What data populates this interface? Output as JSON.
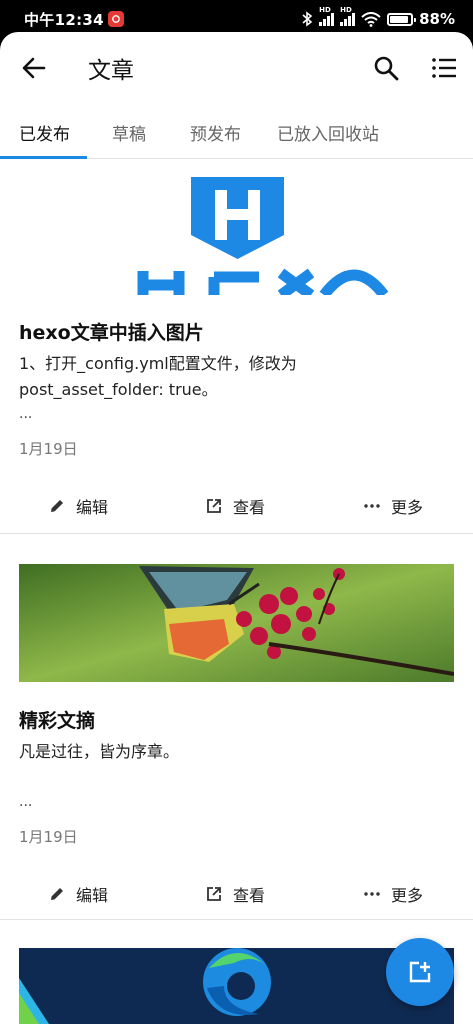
{
  "status_bar": {
    "time": "中午12:34",
    "battery_level": "88%",
    "battery_fraction": 0.88,
    "signal_label_1": "HD",
    "signal_label_2": "HD"
  },
  "appbar": {
    "title": "文章",
    "back_icon": "arrow-left-icon",
    "search_icon": "search-icon",
    "list_icon": "list-icon"
  },
  "tabs": [
    {
      "label": "已发布",
      "active": true
    },
    {
      "label": "草稿",
      "active": false
    },
    {
      "label": "预发布",
      "active": false
    },
    {
      "label": "已放入回收站",
      "active": false
    }
  ],
  "articles": [
    {
      "image": "hexo-logo",
      "image_text": "HEXO",
      "title": "hexo文章中插入图片",
      "excerpt_line1": "1、打开_config.yml配置文件，修改为",
      "excerpt_line2": "post_asset_folder: true。",
      "ellipsis": "...",
      "date": "1月19日",
      "actions": {
        "edit": "编辑",
        "view": "查看",
        "more": "更多"
      }
    },
    {
      "image": "butterfly-photo",
      "title": "精彩文摘",
      "excerpt_line1": "凡是过往，皆为序章。",
      "ellipsis": "...",
      "date": "1月19日",
      "actions": {
        "edit": "编辑",
        "view": "查看",
        "more": "更多"
      }
    },
    {
      "image": "edge-logo-banner"
    }
  ],
  "fab": {
    "icon": "add-post-icon"
  },
  "colors": {
    "accent": "#1e88e5",
    "hexo_blue": "#1e88e5"
  }
}
